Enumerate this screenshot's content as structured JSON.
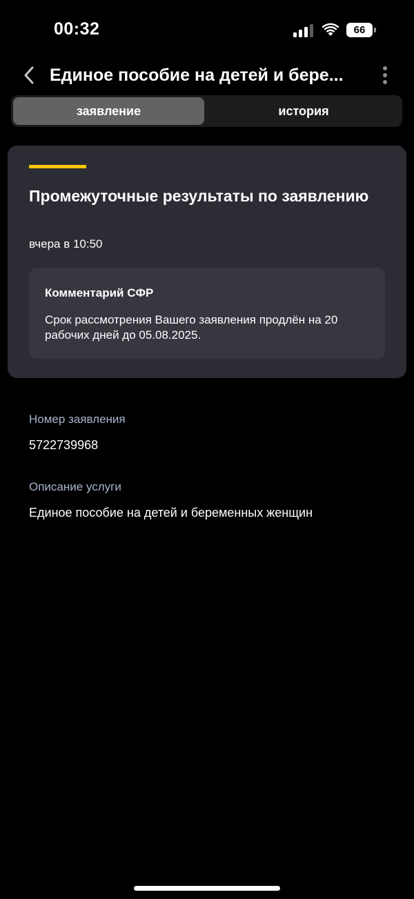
{
  "status_bar": {
    "time": "00:32",
    "battery": "66",
    "icons": [
      "signal-icon",
      "wifi-icon",
      "battery-icon"
    ]
  },
  "header": {
    "title": "Единое пособие на детей и бере...",
    "back_icon": "chevron-left-icon",
    "menu_icon": "more-vertical-icon"
  },
  "tabs": [
    {
      "label": "заявление",
      "active": true
    },
    {
      "label": "история",
      "active": false
    }
  ],
  "result_card": {
    "title": "Промежуточные результаты по заявлению",
    "time": "вчера в 10:50",
    "comment_title": "Комментарий СФР",
    "comment_text": "Срок рассмотрения Вашего заявления продлён на 20 рабочих дней до 05.08.2025.",
    "accent_color": "#ffc800"
  },
  "details": {
    "number_label": "Номер заявления",
    "number_value": "5722739968",
    "service_label": "Описание услуги",
    "service_value": "Единое пособие на детей и беременных женщин"
  },
  "colors": {
    "background": "#000000",
    "card": "#2c2c34",
    "comment_box": "#373740",
    "label": "#a8b4cc"
  }
}
